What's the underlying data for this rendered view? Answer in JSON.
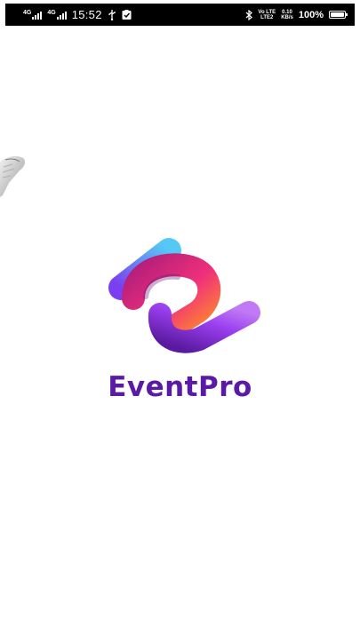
{
  "status_bar": {
    "sim1": "4G",
    "sim2": "4G",
    "time": "15:52",
    "volte": "Vo LTE",
    "volte_line2": "LTE2",
    "speed": "0.10",
    "speed_unit": "KB/s",
    "battery": "100%",
    "battery_level": 1.0,
    "icons": [
      "signal-icon",
      "usb-icon",
      "notification-check-icon",
      "bluetooth-icon",
      "battery-icon"
    ]
  },
  "splash": {
    "app_name": "EventPro",
    "brand_color": "#5b1aa6"
  }
}
